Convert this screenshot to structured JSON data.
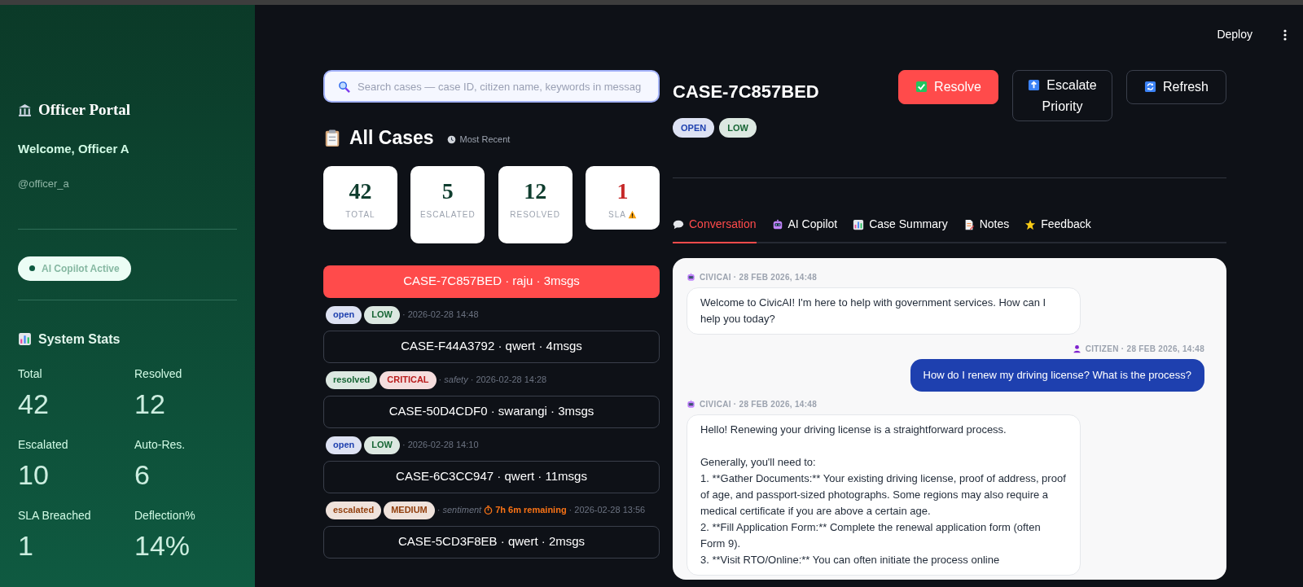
{
  "header": {
    "deploy": "Deploy"
  },
  "sidebar": {
    "title": "Officer Portal",
    "welcome": "Welcome, Officer A",
    "username": "@officer_a",
    "status_pill": "AI Copilot Active",
    "stats_title": "System Stats",
    "stats": [
      {
        "label": "Total",
        "value": "42"
      },
      {
        "label": "Resolved",
        "value": "12"
      },
      {
        "label": "Escalated",
        "value": "10"
      },
      {
        "label": "Auto-Res.",
        "value": "6"
      },
      {
        "label": "SLA Breached",
        "value": "1"
      },
      {
        "label": "Deflection%",
        "value": "14%"
      }
    ]
  },
  "case_list": {
    "search": {
      "placeholder": "Search cases — case ID, citizen name, keywords in messag"
    },
    "title": "All Cases",
    "sort": "Most Recent",
    "summary": [
      {
        "value": "42",
        "label": "TOTAL",
        "alert": false
      },
      {
        "value": "5",
        "label": "ESCALATED",
        "alert": false
      },
      {
        "value": "12",
        "label": "RESOLVED",
        "alert": false
      },
      {
        "value": "1",
        "label": "SLA",
        "alert": true
      }
    ],
    "cases": [
      {
        "label": "CASE-7C857BED · raju · 3msgs",
        "selected": true,
        "tags": [
          {
            "text": "open",
            "color": "#1e40af"
          },
          {
            "text": "LOW",
            "color": "#166534"
          }
        ],
        "meta": "· 2026-02-28 14:48"
      },
      {
        "label": "CASE-F44A3792 · qwert · 4msgs",
        "selected": false,
        "tags": [
          {
            "text": "resolved",
            "color": "#166534"
          },
          {
            "text": "CRITICAL",
            "color": "#b91c1c"
          }
        ],
        "category": "· safety",
        "meta": "· 2026-02-28 14:28"
      },
      {
        "label": "CASE-50D4CDF0 · swarangi · 3msgs",
        "selected": false,
        "tags": [
          {
            "text": "open",
            "color": "#1e40af"
          },
          {
            "text": "LOW",
            "color": "#166534"
          }
        ],
        "meta": "· 2026-02-28 14:10"
      },
      {
        "label": "CASE-6C3CC947 · qwert · 11msgs",
        "selected": false,
        "tags": [
          {
            "text": "escalated",
            "color": "#92400e"
          },
          {
            "text": "MEDIUM",
            "color": "#92400e"
          }
        ],
        "category": "· sentiment",
        "sla": "7h 6m remaining",
        "meta": "· 2026-02-28 13:56"
      },
      {
        "label": "CASE-5CD3F8EB · qwert · 2msgs",
        "selected": false
      }
    ]
  },
  "case_detail": {
    "title": "CASE-7C857BED",
    "badges": [
      {
        "text": "OPEN",
        "color": "#1e40af"
      },
      {
        "text": "LOW",
        "color": "#166534"
      }
    ],
    "buttons": [
      {
        "label": "Resolve",
        "kind": "resolve"
      },
      {
        "label": "Escalate Priority",
        "kind": "escalate"
      },
      {
        "label": "Refresh",
        "kind": "refresh"
      }
    ],
    "tabs": [
      {
        "label": "Conversation",
        "selected": true
      },
      {
        "label": "AI Copilot",
        "selected": false
      },
      {
        "label": "Case Summary",
        "selected": false
      },
      {
        "label": "Notes",
        "selected": false
      },
      {
        "label": "Feedback",
        "selected": false
      }
    ],
    "messages": [
      {
        "kind": "bot",
        "sender": "CIVICAI · 28 FEB 2026, 14:48",
        "text": "Welcome to CivicAI! I'm here to help with government services. How can I help you today?"
      },
      {
        "kind": "citizen",
        "sender": "CITIZEN · 28 FEB 2026, 14:48",
        "text": "How do I renew my driving license? What is the process?"
      },
      {
        "kind": "bot",
        "sender": "CIVICAI · 28 FEB 2026, 14:48",
        "text": "Hello! Renewing your driving license is a straightforward process.\n\nGenerally, you'll need to:\n1. **Gather Documents:** Your existing driving license, proof of address, proof of age, and passport-sized photographs. Some regions may also require a medical certificate if you are above a certain age.\n2. **Fill Application Form:** Complete the renewal application form (often Form 9).\n3. **Visit RTO/Online:** You can often initiate the process online"
      }
    ]
  }
}
